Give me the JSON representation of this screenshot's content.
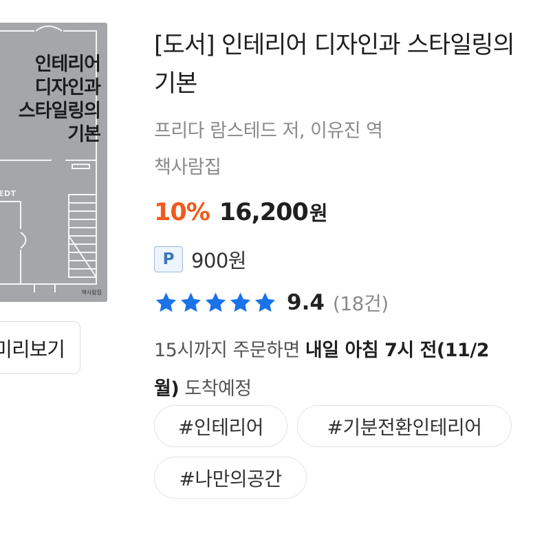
{
  "cover": {
    "title_lines": [
      "인테리어",
      "디자인과",
      "스타일링의",
      "기본"
    ],
    "author": "EDT",
    "publisher": "책사람집",
    "color": "#a4a6a9"
  },
  "preview_button": {
    "label": "미리보기"
  },
  "product": {
    "title_line1": "[도서] 인테리어 디자인과 스타일링의",
    "title_line2": "기본",
    "author_translator": "프리다 람스테드 저, 이유진 역",
    "publisher": "책사람집",
    "discount": "10%",
    "price": "16,200",
    "price_unit": "원",
    "discount_color": "#f05a1a"
  },
  "points": {
    "badge": "P",
    "value": "900원"
  },
  "rating": {
    "stars": 5,
    "score": "9.4",
    "count": "(18건)",
    "star_color": "#1a73e8"
  },
  "delivery": {
    "prefix": "15시까지 주문하면 ",
    "highlight": "내일 아침 7시 전(11/2",
    "highlight_cont": "월)",
    "suffix": " 도착예정"
  },
  "tags": [
    "#인테리어",
    "#기분전환인테리어",
    "#나만의공간"
  ]
}
